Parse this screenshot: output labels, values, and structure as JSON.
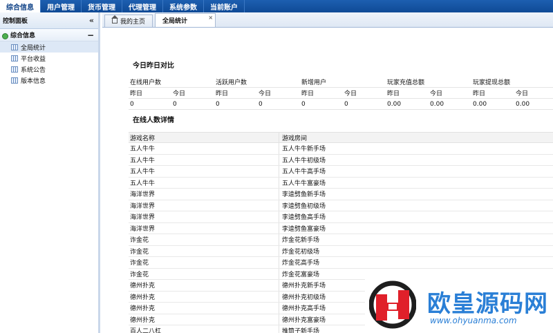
{
  "topnav": [
    "综合信息",
    "用户管理",
    "货币管理",
    "代理管理",
    "系统参数",
    "当前账户"
  ],
  "sidebar": {
    "panel_title": "控制面板",
    "collapse_glyph": "«",
    "group_title": "综合信息",
    "group_toggle": "−",
    "items": [
      {
        "label": "全局统计"
      },
      {
        "label": "平台收益"
      },
      {
        "label": "系统公告"
      },
      {
        "label": "版本信息"
      }
    ]
  },
  "tabs": [
    {
      "label": "我的主页"
    },
    {
      "label": "全局统计"
    }
  ],
  "tab_close": "×",
  "stats": {
    "title": "今日昨日对比",
    "groups": [
      "在线用户数",
      "活跃用户数",
      "新增用户",
      "玩家充值总额",
      "玩家提现总额"
    ],
    "yesterday": "昨日",
    "today": "今日",
    "values": [
      "0",
      "0",
      "0",
      "0",
      "0",
      "0",
      "0.00",
      "0.00",
      "0.00",
      "0.00"
    ]
  },
  "online": {
    "title": "在线人数详情",
    "col_game": "游戏名称",
    "col_room": "游戏房间",
    "rows": [
      {
        "game": "五人牛牛",
        "room": "五人牛牛新手场"
      },
      {
        "game": "五人牛牛",
        "room": "五人牛牛初级场"
      },
      {
        "game": "五人牛牛",
        "room": "五人牛牛高手场"
      },
      {
        "game": "五人牛牛",
        "room": "五人牛牛富豪场"
      },
      {
        "game": "海洋世界",
        "room": "李逵劈鱼新手场"
      },
      {
        "game": "海洋世界",
        "room": "李逵劈鱼初级场"
      },
      {
        "game": "海洋世界",
        "room": "李逵劈鱼高手场"
      },
      {
        "game": "海洋世界",
        "room": "李逵劈鱼富豪场"
      },
      {
        "game": "诈金花",
        "room": "炸金花新手场"
      },
      {
        "game": "诈金花",
        "room": "炸金花初级场"
      },
      {
        "game": "诈金花",
        "room": "炸金花高手场"
      },
      {
        "game": "诈金花",
        "room": "炸金花富豪场"
      },
      {
        "game": "德州扑克",
        "room": "德州扑克新手场"
      },
      {
        "game": "德州扑克",
        "room": "德州扑克初级场"
      },
      {
        "game": "德州扑克",
        "room": "德州扑克高手场"
      },
      {
        "game": "德州扑克",
        "room": "德州扑克富豪场"
      },
      {
        "game": "百人二八杠",
        "room": "推筒子新手场"
      }
    ]
  },
  "watermark": {
    "text": "欧皇源码网",
    "url": "www.ohyuanma.com",
    "colors": {
      "red": "#e0202a",
      "blue": "#2a7fd6"
    }
  }
}
